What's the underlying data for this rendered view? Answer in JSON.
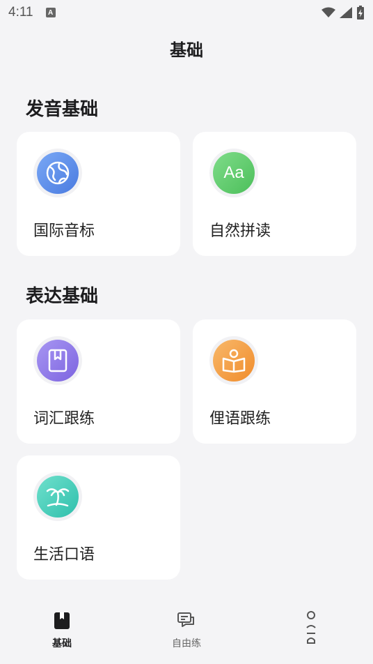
{
  "status_bar": {
    "time": "4:11",
    "notification_badge": "A"
  },
  "header": {
    "title": "基础"
  },
  "sections": [
    {
      "title": "发音基础",
      "cards": [
        {
          "label": "国际音标",
          "icon": "globe-icon",
          "color": "#5b8def"
        },
        {
          "label": "自然拼读",
          "icon": "aa-icon",
          "icon_text": "Aa",
          "color": "#5dcc6a"
        }
      ]
    },
    {
      "title": "表达基础",
      "cards": [
        {
          "label": "词汇跟练",
          "icon": "bookmark-book-icon",
          "color": "#8e78e8"
        },
        {
          "label": "俚语跟练",
          "icon": "reading-person-icon",
          "color": "#f5a043"
        },
        {
          "label": "生活口语",
          "icon": "palm-tree-icon",
          "color": "#3dcab8"
        }
      ]
    }
  ],
  "tab_bar": {
    "tabs": [
      {
        "label": "基础",
        "active": true
      },
      {
        "label": "自由练",
        "active": false
      },
      {
        "label": "",
        "active": false
      }
    ]
  }
}
